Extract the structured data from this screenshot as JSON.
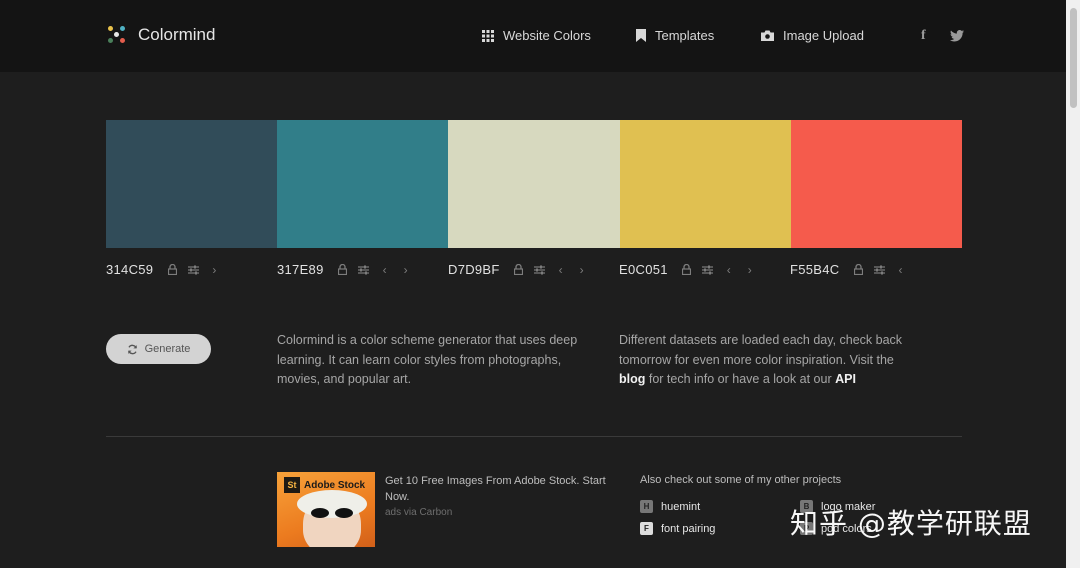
{
  "header": {
    "brand": "Colormind",
    "nav": [
      {
        "label": "Website Colors",
        "icon": "grid-icon"
      },
      {
        "label": "Templates",
        "icon": "bookmark-icon"
      },
      {
        "label": "Image Upload",
        "icon": "camera-icon"
      }
    ],
    "social": [
      {
        "glyph": "f",
        "icon": "facebook-icon"
      },
      {
        "glyph": "t",
        "icon": "twitter-icon"
      }
    ]
  },
  "palette": [
    {
      "hex": "314C59",
      "color": "#314C59"
    },
    {
      "hex": "317E89",
      "color": "#317E89"
    },
    {
      "hex": "D7D9BF",
      "color": "#D7D9BF"
    },
    {
      "hex": "E0C051",
      "color": "#E0C051"
    },
    {
      "hex": "F55B4C",
      "color": "#F55B4C"
    }
  ],
  "generate_label": "Generate",
  "description": {
    "left": "Colormind is a color scheme generator that uses deep learning. It can learn color styles from photographs, movies, and popular art.",
    "right_part1": "Different datasets are loaded each day, check back tomorrow for even more color inspiration. Visit the",
    "right_blog": "blog",
    "right_part2": "for tech info or have a look at our",
    "right_api": "API"
  },
  "ad": {
    "brand": "Adobe Stock",
    "badge": "St",
    "text": "Get 10 Free Images From Adobe Stock. Start Now.",
    "via": "ads via Carbon"
  },
  "other_projects": {
    "title": "Also check out some of my other projects",
    "items": [
      {
        "label": "huemint",
        "icon": "huemint-icon"
      },
      {
        "label": "logo maker",
        "icon": "logo-maker-icon"
      },
      {
        "label": "font pairing",
        "icon": "font-pairing-icon"
      },
      {
        "label": "pod colors",
        "icon": "pod-colors-icon"
      }
    ]
  },
  "watermark": "知乎 @教学研联盟"
}
